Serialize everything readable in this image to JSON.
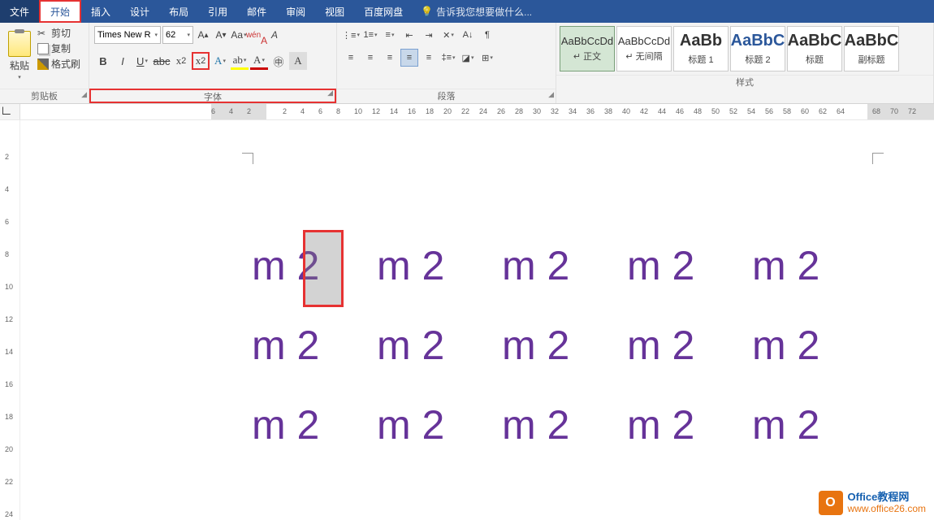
{
  "tabs": {
    "file": "文件",
    "home": "开始",
    "insert": "插入",
    "design": "设计",
    "layout": "布局",
    "references": "引用",
    "mailings": "邮件",
    "review": "审阅",
    "view": "视图",
    "baidu": "百度网盘",
    "tell": "告诉我您想要做什么..."
  },
  "clipboard": {
    "paste": "粘贴",
    "cut": "剪切",
    "copy": "复制",
    "format_painter": "格式刷",
    "group": "剪贴板"
  },
  "font": {
    "name": "Times New R",
    "size": "62",
    "group": "字体"
  },
  "paragraph": {
    "group": "段落"
  },
  "styles": {
    "group": "样式",
    "tiles": [
      {
        "prev": "AaBbCcDd",
        "label": "↵ 正文",
        "cls": "sel"
      },
      {
        "prev": "AaBbCcDd",
        "label": "↵ 无间隔",
        "cls": ""
      },
      {
        "prev": "AaBb",
        "label": "标题 1",
        "cls": "big"
      },
      {
        "prev": "AaBbC",
        "label": "标题 2",
        "cls": "big blue"
      },
      {
        "prev": "AaBbC",
        "label": "标题",
        "cls": "big"
      },
      {
        "prev": "AaBbC",
        "label": "副标题",
        "cls": "big"
      }
    ]
  },
  "ruler": {
    "marks": [
      "6",
      "4",
      "2",
      "",
      "2",
      "4",
      "6",
      "8",
      "10",
      "12",
      "14",
      "16",
      "18",
      "20",
      "22",
      "24",
      "26",
      "28",
      "30",
      "32",
      "34",
      "36",
      "38",
      "40",
      "42",
      "44",
      "46",
      "48",
      "50",
      "52",
      "54",
      "56",
      "58",
      "60",
      "62",
      "64",
      "",
      "68",
      "70",
      "72"
    ]
  },
  "vruler": {
    "marks": [
      "",
      "",
      "2",
      "",
      "4",
      "",
      "6",
      "",
      "8",
      "",
      "10",
      "",
      "12",
      "",
      "14",
      "",
      "16",
      "",
      "18",
      "",
      "20",
      "",
      "22",
      "",
      "24"
    ]
  },
  "doc": {
    "cells": [
      "m 2",
      "m 2",
      "m 2",
      "m 2",
      "m 2",
      "m 2",
      "m 2",
      "m 2",
      "m 2",
      "m 2",
      "m 2",
      "m 2",
      "m 2",
      "m 2",
      "m 2"
    ]
  },
  "watermark": {
    "line1": "Office教程网",
    "line2": "www.office26.com"
  }
}
